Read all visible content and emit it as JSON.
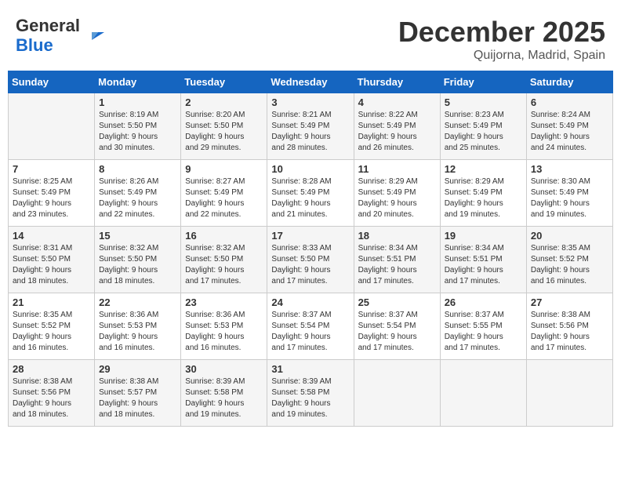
{
  "header": {
    "logo_line1": "General",
    "logo_line2": "Blue",
    "month_year": "December 2025",
    "location": "Quijorna, Madrid, Spain"
  },
  "weekdays": [
    "Sunday",
    "Monday",
    "Tuesday",
    "Wednesday",
    "Thursday",
    "Friday",
    "Saturday"
  ],
  "weeks": [
    [
      {
        "day": null,
        "info": null
      },
      {
        "day": "1",
        "info": "Sunrise: 8:19 AM\nSunset: 5:50 PM\nDaylight: 9 hours\nand 30 minutes."
      },
      {
        "day": "2",
        "info": "Sunrise: 8:20 AM\nSunset: 5:50 PM\nDaylight: 9 hours\nand 29 minutes."
      },
      {
        "day": "3",
        "info": "Sunrise: 8:21 AM\nSunset: 5:49 PM\nDaylight: 9 hours\nand 28 minutes."
      },
      {
        "day": "4",
        "info": "Sunrise: 8:22 AM\nSunset: 5:49 PM\nDaylight: 9 hours\nand 26 minutes."
      },
      {
        "day": "5",
        "info": "Sunrise: 8:23 AM\nSunset: 5:49 PM\nDaylight: 9 hours\nand 25 minutes."
      },
      {
        "day": "6",
        "info": "Sunrise: 8:24 AM\nSunset: 5:49 PM\nDaylight: 9 hours\nand 24 minutes."
      }
    ],
    [
      {
        "day": "7",
        "info": "Sunrise: 8:25 AM\nSunset: 5:49 PM\nDaylight: 9 hours\nand 23 minutes."
      },
      {
        "day": "8",
        "info": "Sunrise: 8:26 AM\nSunset: 5:49 PM\nDaylight: 9 hours\nand 22 minutes."
      },
      {
        "day": "9",
        "info": "Sunrise: 8:27 AM\nSunset: 5:49 PM\nDaylight: 9 hours\nand 22 minutes."
      },
      {
        "day": "10",
        "info": "Sunrise: 8:28 AM\nSunset: 5:49 PM\nDaylight: 9 hours\nand 21 minutes."
      },
      {
        "day": "11",
        "info": "Sunrise: 8:29 AM\nSunset: 5:49 PM\nDaylight: 9 hours\nand 20 minutes."
      },
      {
        "day": "12",
        "info": "Sunrise: 8:29 AM\nSunset: 5:49 PM\nDaylight: 9 hours\nand 19 minutes."
      },
      {
        "day": "13",
        "info": "Sunrise: 8:30 AM\nSunset: 5:49 PM\nDaylight: 9 hours\nand 19 minutes."
      }
    ],
    [
      {
        "day": "14",
        "info": "Sunrise: 8:31 AM\nSunset: 5:50 PM\nDaylight: 9 hours\nand 18 minutes."
      },
      {
        "day": "15",
        "info": "Sunrise: 8:32 AM\nSunset: 5:50 PM\nDaylight: 9 hours\nand 18 minutes."
      },
      {
        "day": "16",
        "info": "Sunrise: 8:32 AM\nSunset: 5:50 PM\nDaylight: 9 hours\nand 17 minutes."
      },
      {
        "day": "17",
        "info": "Sunrise: 8:33 AM\nSunset: 5:50 PM\nDaylight: 9 hours\nand 17 minutes."
      },
      {
        "day": "18",
        "info": "Sunrise: 8:34 AM\nSunset: 5:51 PM\nDaylight: 9 hours\nand 17 minutes."
      },
      {
        "day": "19",
        "info": "Sunrise: 8:34 AM\nSunset: 5:51 PM\nDaylight: 9 hours\nand 17 minutes."
      },
      {
        "day": "20",
        "info": "Sunrise: 8:35 AM\nSunset: 5:52 PM\nDaylight: 9 hours\nand 16 minutes."
      }
    ],
    [
      {
        "day": "21",
        "info": "Sunrise: 8:35 AM\nSunset: 5:52 PM\nDaylight: 9 hours\nand 16 minutes."
      },
      {
        "day": "22",
        "info": "Sunrise: 8:36 AM\nSunset: 5:53 PM\nDaylight: 9 hours\nand 16 minutes."
      },
      {
        "day": "23",
        "info": "Sunrise: 8:36 AM\nSunset: 5:53 PM\nDaylight: 9 hours\nand 16 minutes."
      },
      {
        "day": "24",
        "info": "Sunrise: 8:37 AM\nSunset: 5:54 PM\nDaylight: 9 hours\nand 17 minutes."
      },
      {
        "day": "25",
        "info": "Sunrise: 8:37 AM\nSunset: 5:54 PM\nDaylight: 9 hours\nand 17 minutes."
      },
      {
        "day": "26",
        "info": "Sunrise: 8:37 AM\nSunset: 5:55 PM\nDaylight: 9 hours\nand 17 minutes."
      },
      {
        "day": "27",
        "info": "Sunrise: 8:38 AM\nSunset: 5:56 PM\nDaylight: 9 hours\nand 17 minutes."
      }
    ],
    [
      {
        "day": "28",
        "info": "Sunrise: 8:38 AM\nSunset: 5:56 PM\nDaylight: 9 hours\nand 18 minutes."
      },
      {
        "day": "29",
        "info": "Sunrise: 8:38 AM\nSunset: 5:57 PM\nDaylight: 9 hours\nand 18 minutes."
      },
      {
        "day": "30",
        "info": "Sunrise: 8:39 AM\nSunset: 5:58 PM\nDaylight: 9 hours\nand 19 minutes."
      },
      {
        "day": "31",
        "info": "Sunrise: 8:39 AM\nSunset: 5:58 PM\nDaylight: 9 hours\nand 19 minutes."
      },
      {
        "day": null,
        "info": null
      },
      {
        "day": null,
        "info": null
      },
      {
        "day": null,
        "info": null
      }
    ]
  ]
}
